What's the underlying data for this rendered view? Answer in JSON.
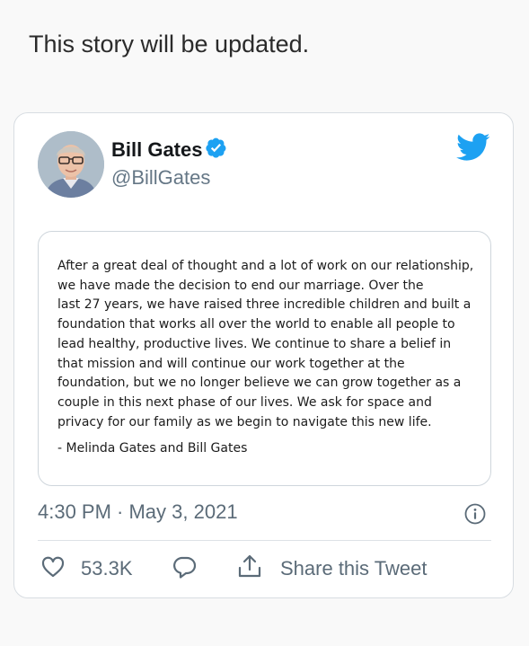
{
  "story_note": "This story will be updated.",
  "tweet": {
    "author": {
      "name": "Bill Gates",
      "handle": "@BillGates",
      "verified": true
    },
    "statement": {
      "lines": [
        "After a great deal of thought and a lot of work on our relationship,",
        "we have made the decision to end our marriage. Over the",
        "last 27 years, we have raised three incredible children and built a",
        "foundation that works all over the world to enable all people to",
        "lead healthy, productive lives. We continue to share a belief in",
        "that mission and will continue our work together at the",
        "foundation, but we no longer believe we can grow together as a",
        "couple in this next phase of our lives. We ask for space and",
        "privacy for our family as we begin to navigate this new life."
      ],
      "signature": "- Melinda Gates and Bill Gates"
    },
    "timestamp": "4:30 PM · May 3, 2021",
    "actions": {
      "like_count": "53.3K",
      "share_label": "Share this Tweet"
    }
  },
  "icons": {
    "verified": "verified-badge-icon",
    "brand": "twitter-bird-icon",
    "info": "info-icon",
    "like": "heart-icon",
    "reply": "reply-bubble-icon",
    "share": "share-upload-icon"
  },
  "colors": {
    "twitter_blue": "#1da1f2",
    "secondary_text": "#5b6b78",
    "name_text": "#14171a"
  }
}
